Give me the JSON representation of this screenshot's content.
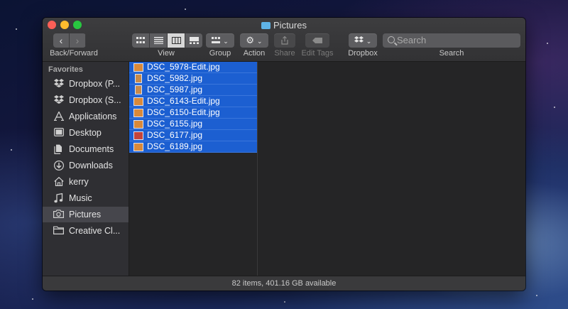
{
  "window": {
    "title": "Pictures"
  },
  "toolbar": {
    "back_forward_label": "Back/Forward",
    "view_label": "View",
    "group_label": "Group",
    "action_label": "Action",
    "share_label": "Share",
    "edit_tags_label": "Edit Tags",
    "dropbox_label": "Dropbox",
    "search_label": "Search",
    "search_placeholder": "Search",
    "view_modes": [
      "icon",
      "list",
      "column",
      "gallery"
    ],
    "active_view": "column"
  },
  "sidebar": {
    "heading": "Favorites",
    "items": [
      {
        "label": "Dropbox (P...",
        "icon": "dropbox-icon"
      },
      {
        "label": "Dropbox (S...",
        "icon": "dropbox-icon"
      },
      {
        "label": "Applications",
        "icon": "applications-icon"
      },
      {
        "label": "Desktop",
        "icon": "desktop-icon"
      },
      {
        "label": "Documents",
        "icon": "documents-icon"
      },
      {
        "label": "Downloads",
        "icon": "downloads-icon"
      },
      {
        "label": "kerry",
        "icon": "home-icon"
      },
      {
        "label": "Music",
        "icon": "music-icon"
      },
      {
        "label": "Pictures",
        "icon": "camera-icon"
      },
      {
        "label": "Creative Cl...",
        "icon": "folder-icon"
      }
    ],
    "active_item": "Pictures"
  },
  "files": [
    {
      "name": "DSC_5978-Edit.jpg",
      "thumb": "landscape"
    },
    {
      "name": "DSC_5982.jpg",
      "thumb": "portrait"
    },
    {
      "name": "DSC_5987.jpg",
      "thumb": "portrait"
    },
    {
      "name": "DSC_6143-Edit.jpg",
      "thumb": "landscape"
    },
    {
      "name": "DSC_6150-Edit.jpg",
      "thumb": "landscape"
    },
    {
      "name": "DSC_6155.jpg",
      "thumb": "landscape"
    },
    {
      "name": "DSC_6177.jpg",
      "thumb": "red"
    },
    {
      "name": "DSC_6189.jpg",
      "thumb": "landscape"
    }
  ],
  "status": {
    "text": "82 items, 401.16 GB available"
  },
  "colors": {
    "selection": "#1c5fd1",
    "close": "#fc5f57",
    "minimize": "#fdbc2e",
    "maximize": "#28c840"
  }
}
